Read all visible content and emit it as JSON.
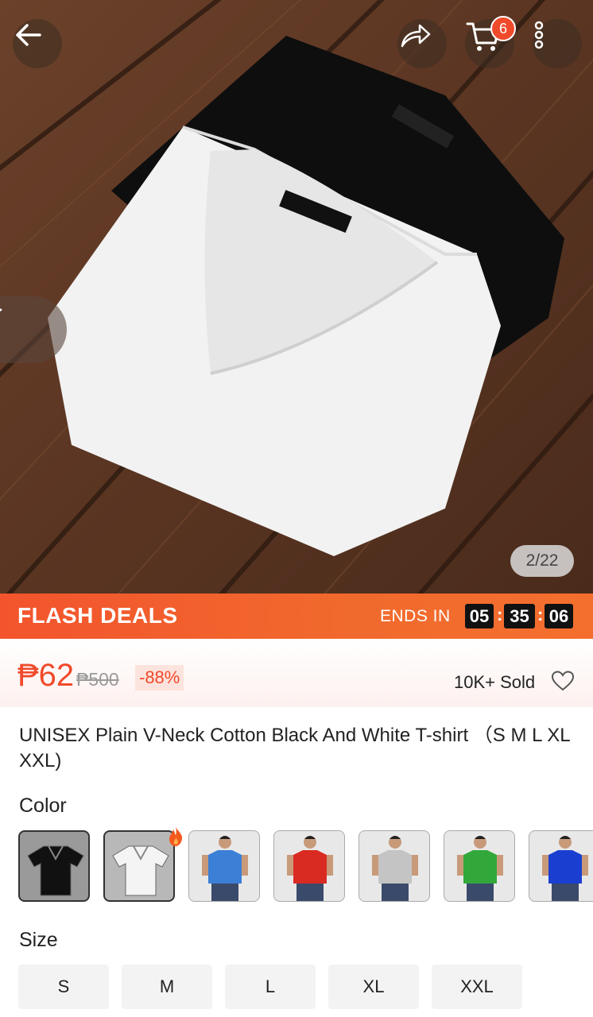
{
  "hero": {
    "image_counter": "2/22"
  },
  "topbar": {
    "cart_count": "6"
  },
  "flash": {
    "title": "FLASH DEALS",
    "ends_label": "ENDS IN",
    "hours": "05",
    "minutes": "35",
    "seconds": "06"
  },
  "price": {
    "current": "₱62",
    "original": "₱500",
    "discount": "-88%",
    "sold": "10K+ Sold"
  },
  "product": {
    "title": "UNISEX Plain V-Neck Cotton Black And White T-shirt （S M L XL XXL)"
  },
  "color": {
    "label": "Color",
    "options": [
      {
        "name": "black",
        "color": "#111111",
        "bg": "#9a9a9a"
      },
      {
        "name": "white",
        "color": "#f4f4f4",
        "bg": "#b8b8b8"
      },
      {
        "name": "blue",
        "color": "#3b7fd6",
        "bg": "#e8e8e8"
      },
      {
        "name": "red",
        "color": "#d92b22",
        "bg": "#e8e8e8"
      },
      {
        "name": "grey",
        "color": "#c4c4c4",
        "bg": "#e8e8e8"
      },
      {
        "name": "green",
        "color": "#32a83a",
        "bg": "#e8e8e8"
      },
      {
        "name": "royal-blue",
        "color": "#1a3fd0",
        "bg": "#e8e8e8"
      }
    ]
  },
  "size": {
    "label": "Size",
    "options": [
      "S",
      "M",
      "L",
      "XL",
      "XXL"
    ]
  }
}
